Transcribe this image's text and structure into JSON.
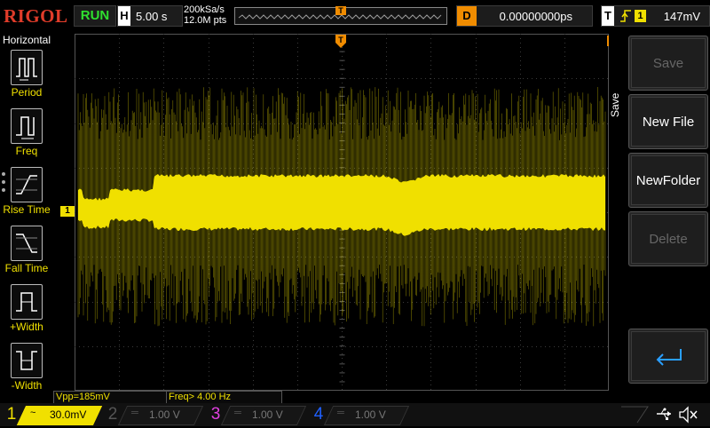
{
  "header": {
    "logo": "RIGOL",
    "run_state": "RUN",
    "timebase_tag": "H",
    "timebase": "5.00 s",
    "sample_rate": "200kSa/s",
    "memory_depth": "12.0M pts",
    "trigger_marker": "T",
    "delay_tag": "D",
    "delay": "0.00000000ps",
    "trigger_tag": "T",
    "trigger_edge": "rising-edge-icon",
    "trigger_source": "1",
    "trigger_level": "147mV"
  },
  "left_menu": {
    "title": "Horizontal",
    "items": [
      {
        "label": "Period",
        "icon": "period-icon"
      },
      {
        "label": "Freq",
        "icon": "frequency-icon"
      },
      {
        "label": "Rise Time",
        "icon": "rise-time-icon"
      },
      {
        "label": "Fall Time",
        "icon": "fall-time-icon"
      },
      {
        "label": "+Width",
        "icon": "positive-width-icon"
      },
      {
        "label": "-Width",
        "icon": "negative-width-icon"
      }
    ]
  },
  "right_menu": {
    "title": "Save",
    "buttons": [
      {
        "label": "Save",
        "enabled": false
      },
      {
        "label": "New File",
        "enabled": true
      },
      {
        "label": "NewFolder",
        "enabled": true
      },
      {
        "label": "Delete",
        "enabled": false
      },
      {
        "label": "",
        "icon": "return-arrow-icon",
        "enabled": true
      }
    ]
  },
  "measurements": [
    {
      "label": "Vpp=185mV"
    },
    {
      "label": "Freq> 4.00 Hz"
    }
  ],
  "channel_ref": "1",
  "channels": [
    {
      "num": "1",
      "coupling": "~",
      "scale": "30.0mV",
      "active": true,
      "color": "#f0e000"
    },
    {
      "num": "2",
      "coupling": "═",
      "scale": "1.00 V",
      "active": false,
      "color": "#27b5ff"
    },
    {
      "num": "3",
      "coupling": "═",
      "scale": "1.00 V",
      "active": false,
      "color": "#e040e0"
    },
    {
      "num": "4",
      "coupling": "═",
      "scale": "1.00 V",
      "active": false,
      "color": "#2060ff"
    }
  ],
  "colors": {
    "ch1": "#f0e000",
    "trigger": "#f08c00",
    "run": "#2fe02f",
    "logo": "#e03c2a"
  },
  "status_icons": [
    "usb-icon",
    "speaker-mute-icon"
  ]
}
